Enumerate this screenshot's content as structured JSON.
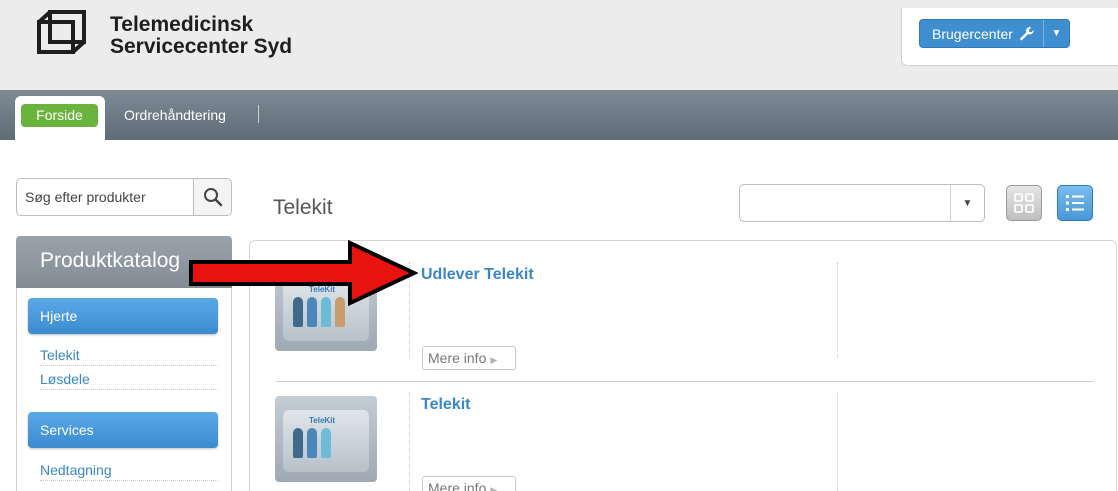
{
  "header": {
    "brand_line1": "Telemedicinsk",
    "brand_line2": "Servicecenter Syd",
    "user_button_label": "Brugercenter"
  },
  "nav": {
    "tabs": [
      {
        "label": "Forside",
        "active": true
      },
      {
        "label": "Ordrehåndtering",
        "active": false
      }
    ]
  },
  "search": {
    "placeholder": "Søg efter produkter"
  },
  "sidebar": {
    "catalog_title": "Produktkatalog",
    "groups": [
      {
        "label": "Hjerte",
        "links": [
          "Telekit",
          "Løsdele"
        ]
      },
      {
        "label": "Services",
        "links": [
          "Nedtagning"
        ]
      }
    ]
  },
  "main": {
    "title": "Telekit",
    "sort_select_value": "",
    "products": [
      {
        "title": "Udlever Telekit",
        "image_logo": "TeleKit",
        "more_label": "Mere info"
      },
      {
        "title": "Telekit",
        "image_logo": "TeleKit",
        "more_label": "Mere info"
      }
    ]
  },
  "colors": {
    "accent_blue": "#3a87c5",
    "active_tab_green": "#6ab43e",
    "nav_gray": "#6e7b87",
    "annotation_red": "#e8130f"
  },
  "icons": {
    "logo": "stacked-squares-logo-icon",
    "user_button": "wrench-icon",
    "search": "magnifier-icon",
    "grid_view": "grid-icon",
    "list_view": "list-icon",
    "annotation": "red-arrow-icon"
  }
}
